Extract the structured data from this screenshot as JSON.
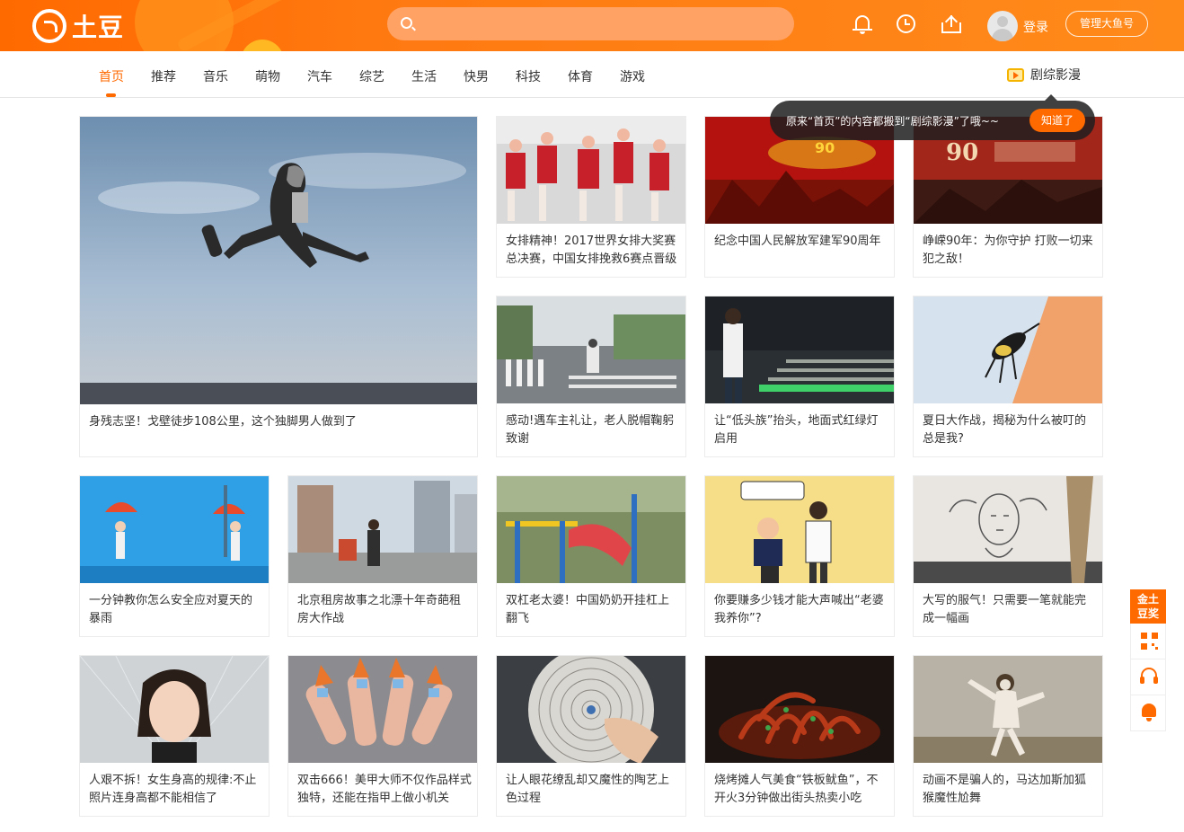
{
  "brand": {
    "logo_text": "土豆"
  },
  "search": {
    "placeholder": ""
  },
  "header": {
    "login": "登录",
    "manage": "管理大鱼号"
  },
  "nav": {
    "items": [
      "首页",
      "推荐",
      "音乐",
      "萌物",
      "汽车",
      "综艺",
      "生活",
      "快男",
      "科技",
      "体育",
      "游戏"
    ],
    "active": "首页",
    "drama_label": "剧综影漫"
  },
  "tooltip": {
    "message": "原来“首页”的内容都搬到“剧综影漫”了哦~~",
    "button": "知道了"
  },
  "featured": {
    "caption": "身残志坚！戈壁徒步108公里，这个独脚男人做到了"
  },
  "videos": [
    {
      "caption": "女排精神！2017世界女排大奖赛总决赛，中国女排挽救6赛点晋级"
    },
    {
      "caption": "纪念中国人民解放军建军90周年"
    },
    {
      "caption": "峥嵘90年：为你守护 打败一切来犯之敌！"
    },
    {
      "caption": "感动!遇车主礼让，老人脱帽鞠躬致谢"
    },
    {
      "caption": "让“低头族”抬头，地面式红绿灯启用"
    },
    {
      "caption": "夏日大作战，揭秘为什么被叮的总是我?"
    },
    {
      "caption": "一分钟教你怎么安全应对夏天的暴雨"
    },
    {
      "caption": "北京租房故事之北漂十年奇葩租房大作战"
    },
    {
      "caption": "双杠老太婆！中国奶奶开挂杠上翻飞"
    },
    {
      "caption": "你要赚多少钱才能大声喊出“老婆我养你”?"
    },
    {
      "caption": "大写的服气！只需要一笔就能完成一幅画"
    },
    {
      "caption": "人艰不拆！女生身高的规律:不止照片连身高都不能相信了"
    },
    {
      "caption": "双击666！美甲大师不仅作品样式独特，还能在指甲上做小机关"
    },
    {
      "caption": "让人眼花缭乱却又魔性的陶艺上色过程"
    },
    {
      "caption": "烧烤摊人气美食“铁板鱿鱼”，不开火3分钟做出街头热卖小吃"
    },
    {
      "caption": "动画不是骗人的，马达加斯加狐猴魔性尬舞"
    }
  ],
  "sidebar": {
    "gold_line1": "金土",
    "gold_line2": "豆奖"
  },
  "thumb_banners": {
    "army": "纪念中国人民解放军建军90周年",
    "army2": "峥嵘90年 为你守护"
  },
  "colors": {
    "brand": "#ff6a00",
    "search_bg": "#ffa264"
  }
}
